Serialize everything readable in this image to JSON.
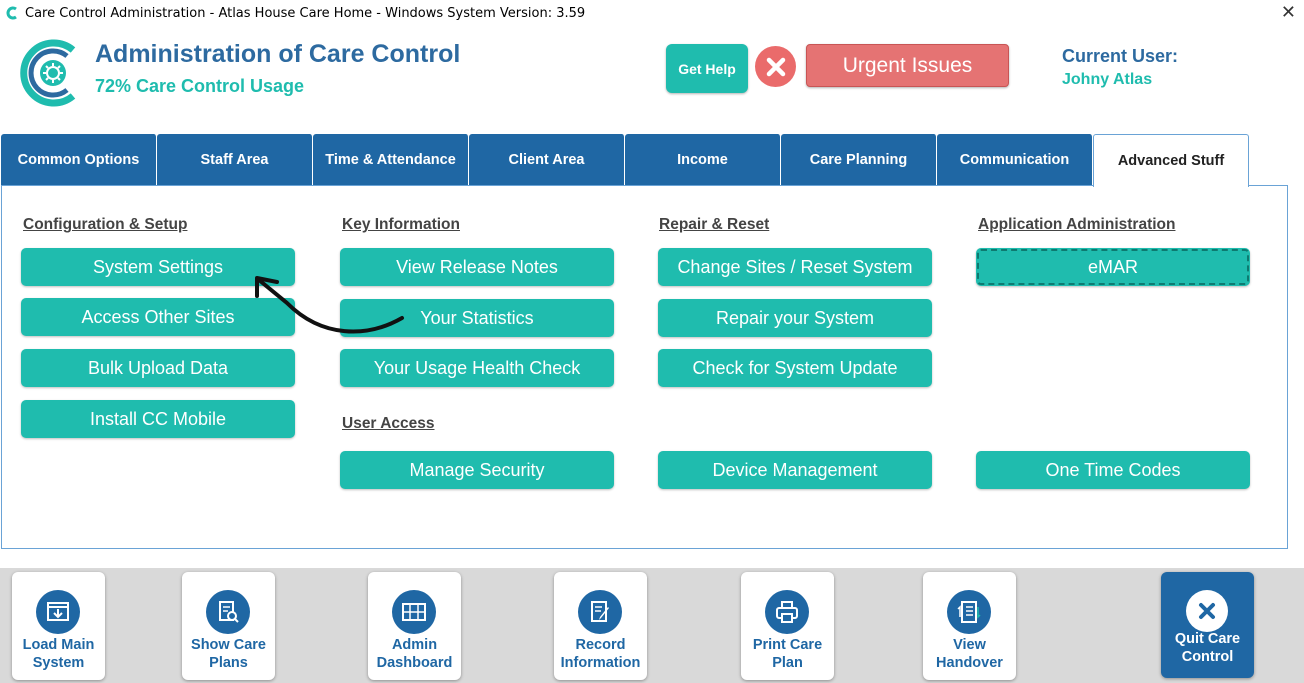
{
  "window": {
    "title": "Care Control Administration - Atlas House Care Home - Windows System Version: 3.59",
    "close_glyph": "✕"
  },
  "header": {
    "title": "Administration of Care Control",
    "usage": "72% Care Control Usage",
    "get_help": "Get Help",
    "urgent_issues": "Urgent Issues",
    "current_user_label": "Current User:",
    "current_user_name": "Johny Atlas"
  },
  "tabs": [
    {
      "label": "Common Options"
    },
    {
      "label": "Staff Area"
    },
    {
      "label": "Time & Attendance"
    },
    {
      "label": "Client Area"
    },
    {
      "label": "Income"
    },
    {
      "label": "Care Planning"
    },
    {
      "label": "Communication"
    },
    {
      "label": "Advanced Stuff",
      "active": true
    }
  ],
  "sections": {
    "config": {
      "title": "Configuration & Setup",
      "buttons": [
        "System Settings",
        "Access Other Sites",
        "Bulk Upload Data",
        "Install CC Mobile"
      ]
    },
    "key_info": {
      "title": "Key Information",
      "buttons": [
        "View Release Notes",
        "Your Statistics",
        "Your Usage Health Check"
      ]
    },
    "repair": {
      "title": "Repair & Reset",
      "buttons": [
        "Change Sites / Reset System",
        "Repair your System",
        "Check for System Update"
      ]
    },
    "app_admin": {
      "title": "Application Administration",
      "buttons": [
        "eMAR"
      ]
    },
    "user_access": {
      "title": "User Access",
      "buttons": [
        "Manage Security",
        "Device Management",
        "One Time Codes"
      ]
    }
  },
  "bottom_bar": [
    {
      "line1": "Load Main",
      "line2": "System",
      "icon": "download-window-icon"
    },
    {
      "line1": "Show Care",
      "line2": "Plans",
      "icon": "document-search-icon"
    },
    {
      "line1": "Admin",
      "line2": "Dashboard",
      "icon": "dashboard-grid-icon"
    },
    {
      "line1": "Record",
      "line2": "Information",
      "icon": "edit-document-icon"
    },
    {
      "line1": "Print Care",
      "line2": "Plan",
      "icon": "printer-icon"
    },
    {
      "line1": "View",
      "line2": "Handover",
      "icon": "checklist-icon"
    },
    {
      "line1": "Quit Care",
      "line2": "Control",
      "icon": "close-circle-icon"
    }
  ],
  "colors": {
    "brand_blue": "#1f67a4",
    "teal": "#1fbcae",
    "urgent_red": "#e57373"
  }
}
